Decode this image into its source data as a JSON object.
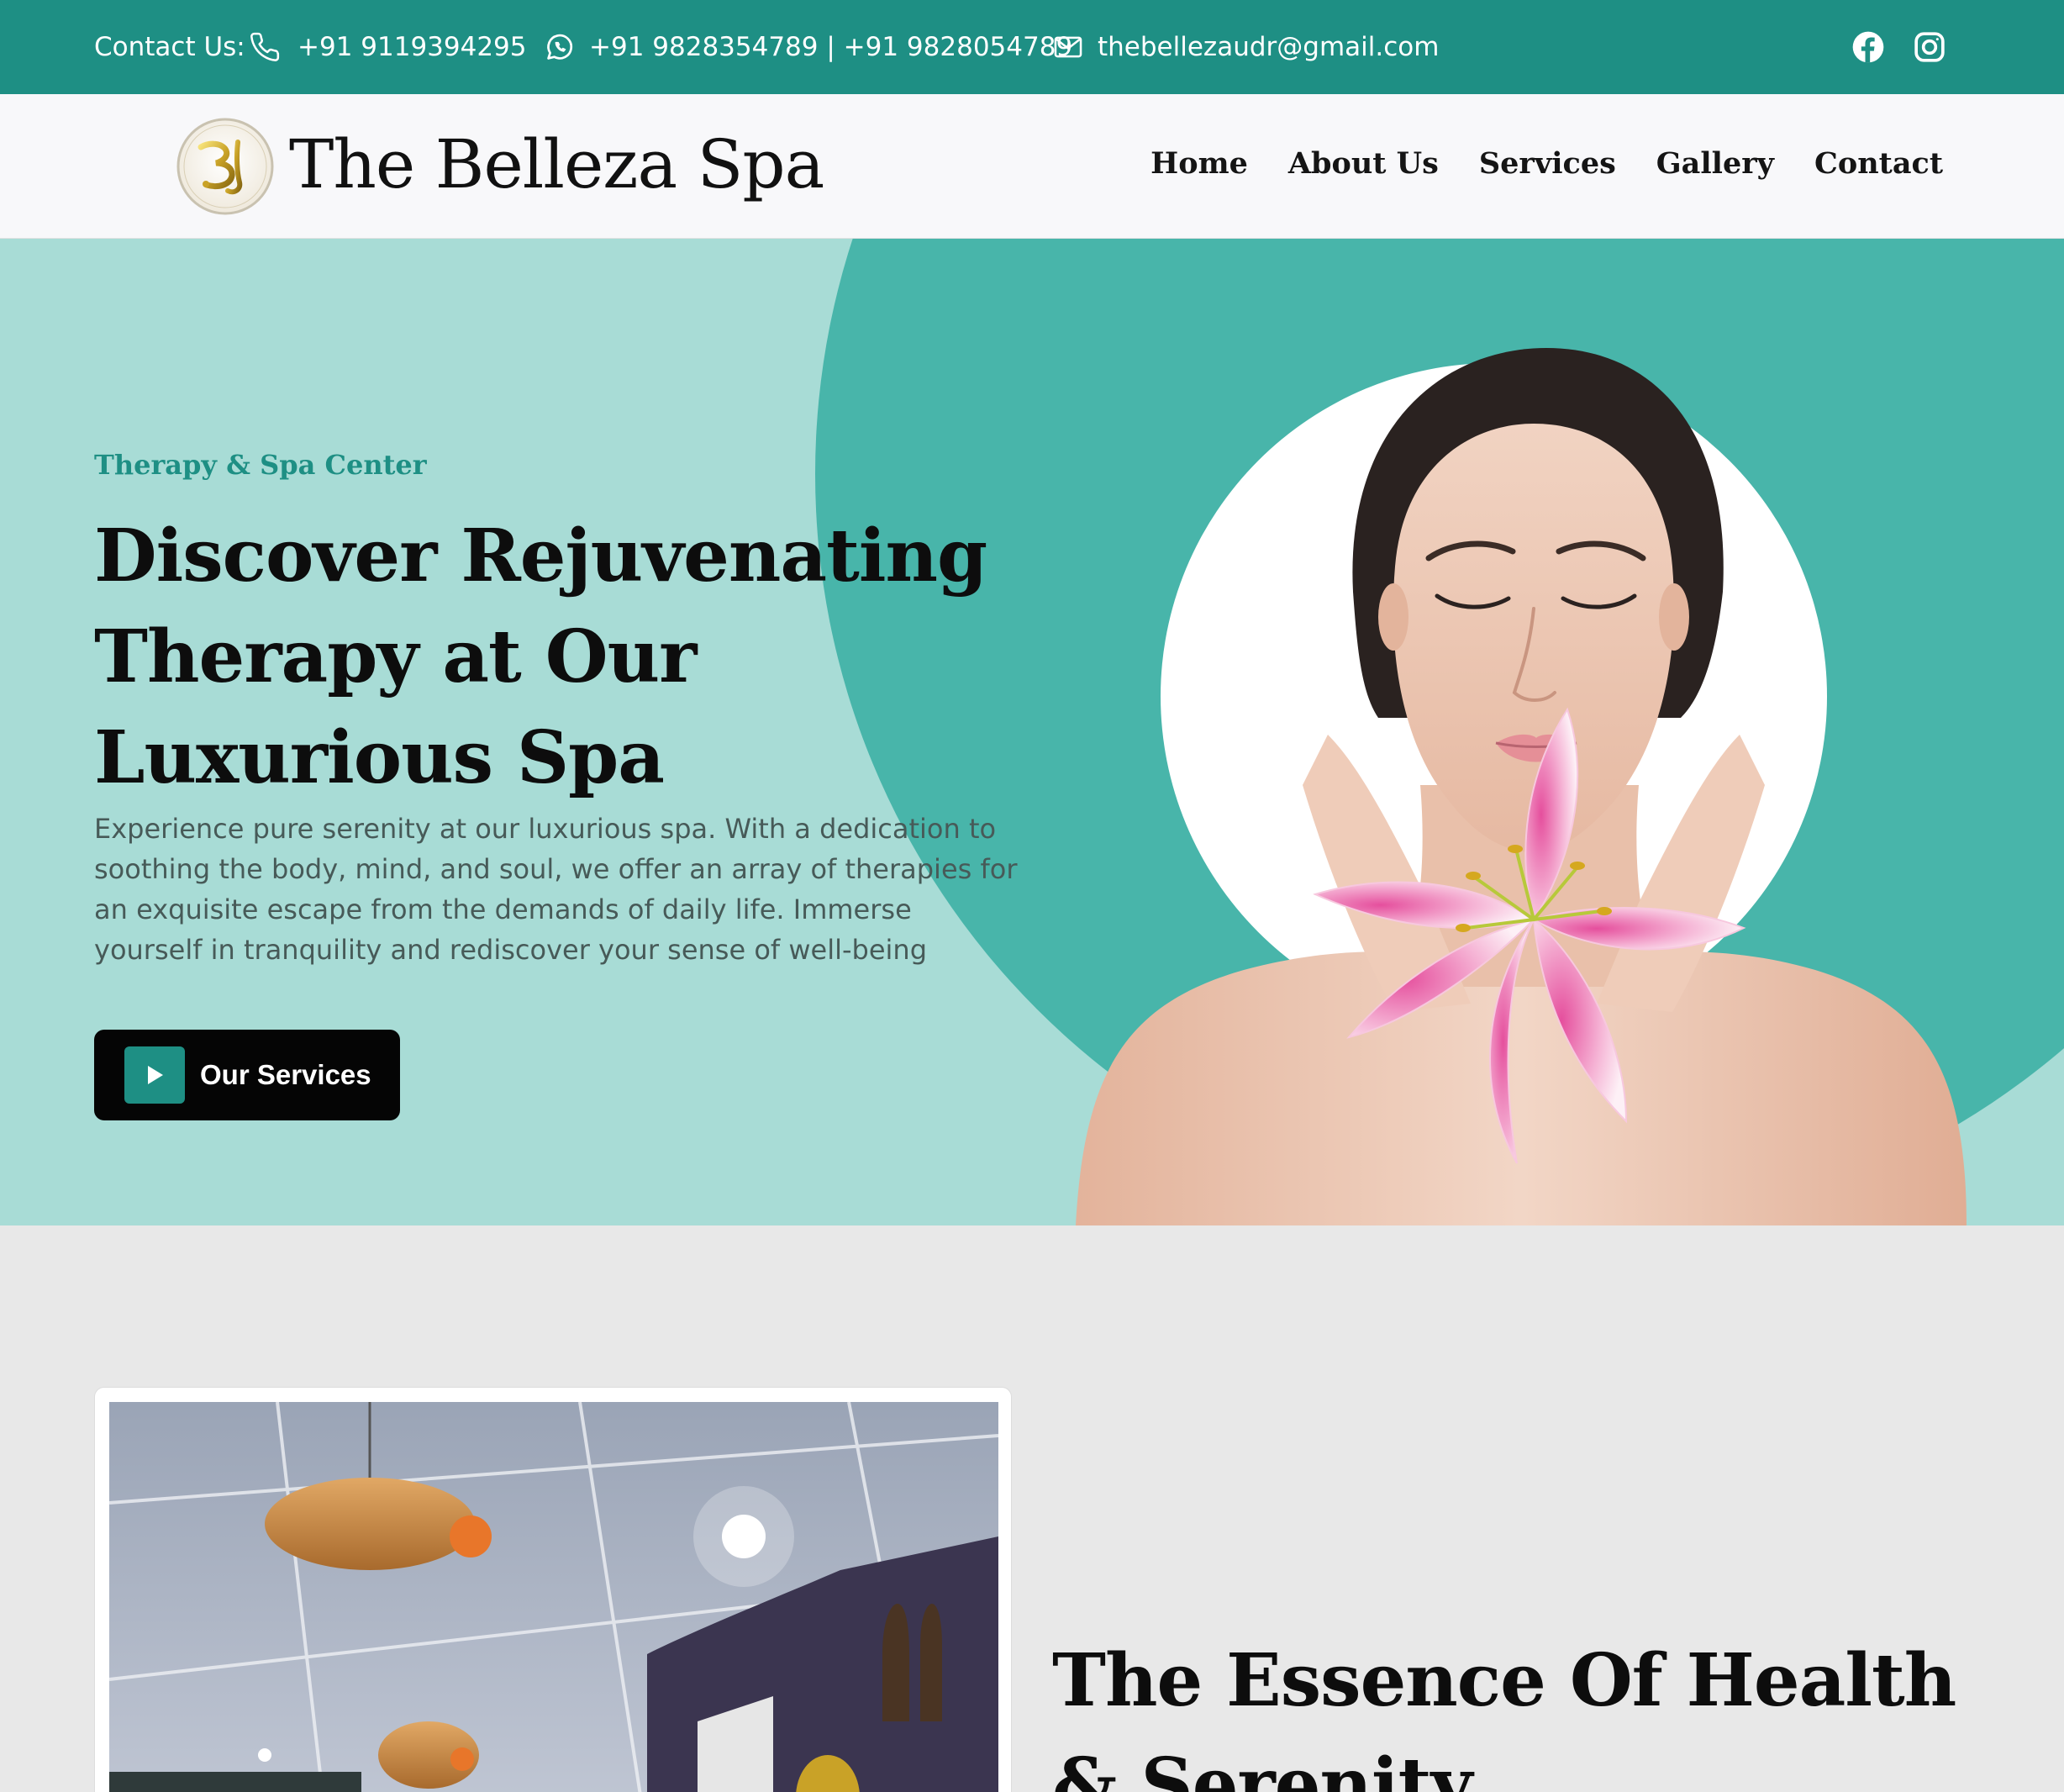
{
  "topbar": {
    "contact_label": "Contact Us:",
    "phone": "+91 9119394295",
    "whatsapp": "+91 9828354789 | +91 9828054789",
    "email": "thebellezaudr@gmail.com",
    "social": [
      "facebook-icon",
      "instagram-icon"
    ],
    "background": "#1e8f84"
  },
  "header": {
    "brand": "The Belleza Spa",
    "nav": [
      "Home",
      "About Us",
      "Services",
      "Gallery",
      "Contact"
    ]
  },
  "hero": {
    "eyebrow": "Therapy & Spa Center",
    "title": "Discover Rejuvenating Therapy at Our Luxurious Spa",
    "text": "Experience pure serenity at our luxurious spa. With a dedication to soothing the body, mind, and soul, we offer an array of therapies for an exquisite escape from the demands of daily life. Immerse yourself in tranquility and rediscover your sense of well-being",
    "cta_label": "Our Services",
    "colors": {
      "background": "#a8dcd6",
      "circle": "#48b5aa",
      "accent": "#1e8f84"
    }
  },
  "about": {
    "title": "The Essence Of Health & Serenity"
  }
}
